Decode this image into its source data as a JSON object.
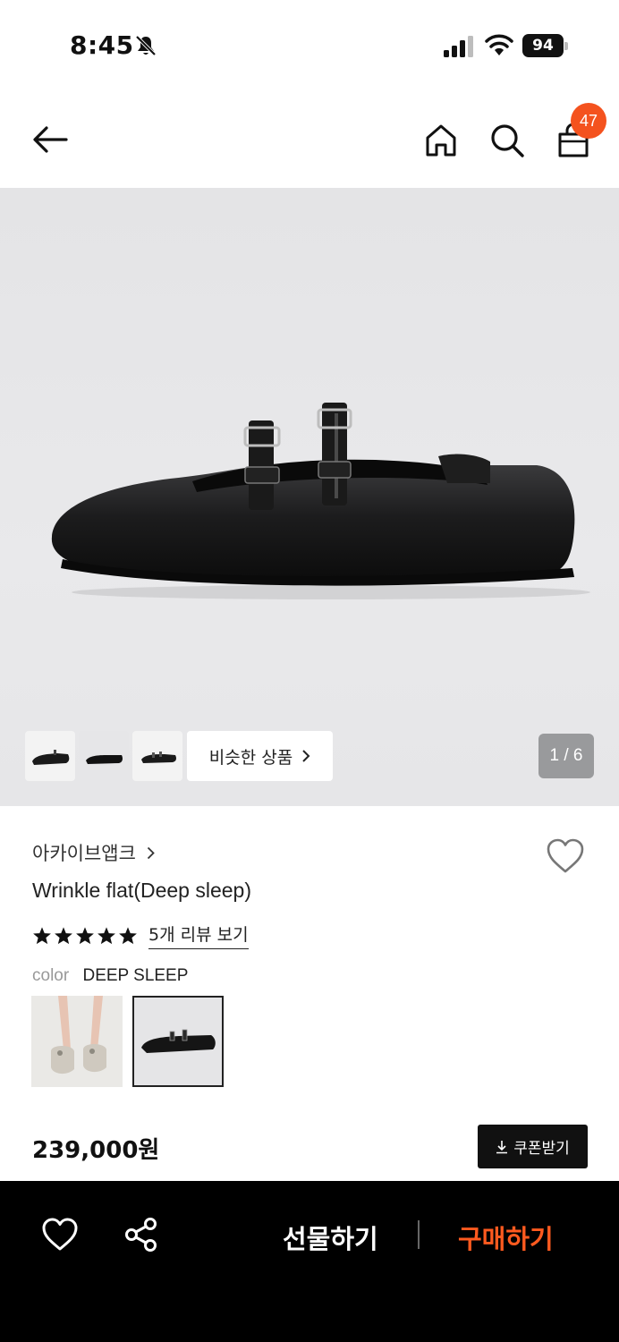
{
  "status_bar": {
    "time": "8:45",
    "battery": "94",
    "icons": [
      "bell-muted-icon",
      "cellular-signal-icon",
      "wifi-icon",
      "battery-icon"
    ]
  },
  "header": {
    "cart_count": "47",
    "icons": [
      "back-arrow-icon",
      "home-icon",
      "search-icon",
      "shopping-bag-icon"
    ]
  },
  "gallery": {
    "similar_button": "비슷한 상품",
    "page_indicator": "1 / 6"
  },
  "product": {
    "brand": "아카이브앱크",
    "name": "Wrinkle flat(Deep sleep)",
    "review_link": "5개 리뷰 보기",
    "rating": 5,
    "color_label": "color",
    "color_value": "DEEP SLEEP",
    "price": "239,000원",
    "coupon_button": "쿠폰받기"
  },
  "bottom_bar": {
    "gift_label": "선물하기",
    "buy_label": "구매하기"
  },
  "colors": {
    "accent": "#ff5a1f",
    "badge": "#f4521e",
    "bottom_bar_bg": "#000000"
  }
}
